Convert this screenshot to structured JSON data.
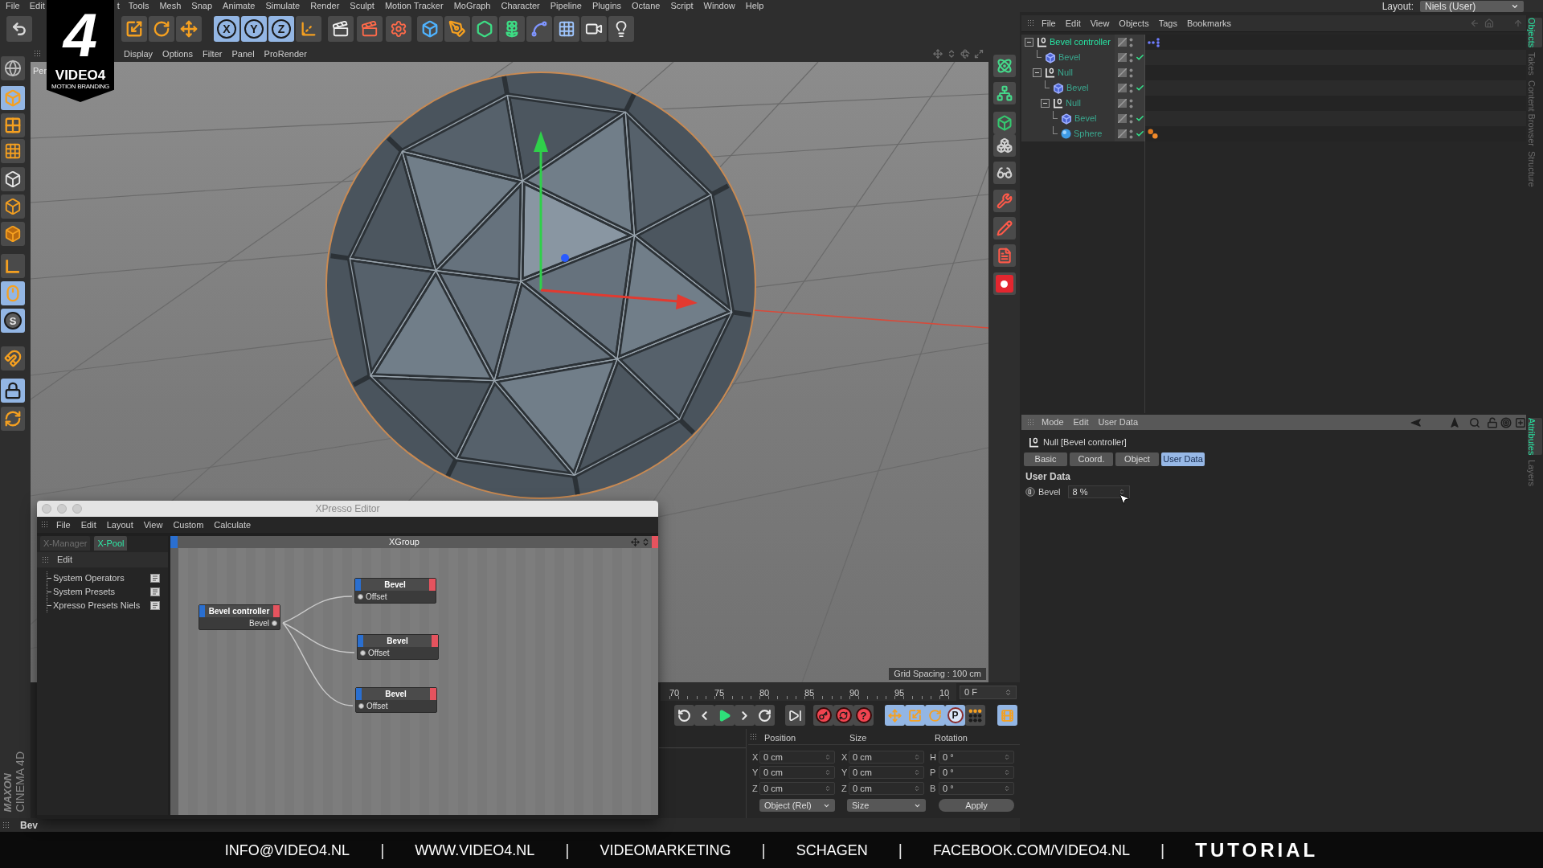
{
  "brand_logo": {
    "mark": "4",
    "name": "VIDEO4",
    "tagline": "MOTION BRANDING"
  },
  "menu_bar": {
    "items": [
      "File",
      "Edit",
      "t",
      "Tools",
      "Mesh",
      "Snap",
      "Animate",
      "Simulate",
      "Render",
      "Sculpt",
      "Motion Tracker",
      "MoGraph",
      "Character",
      "Pipeline",
      "Plugins",
      "Octane",
      "Script",
      "Window",
      "Help"
    ],
    "layout_label": "Layout:",
    "layout_value": "Niels (User)"
  },
  "toolbar": [
    {
      "kind": "undo",
      "on": false
    },
    {
      "kind": "scale",
      "on": false
    },
    {
      "kind": "rotate",
      "on": false
    },
    {
      "kind": "move",
      "on": false
    },
    {
      "kind": "axis",
      "label": "X",
      "on": true
    },
    {
      "kind": "axis",
      "label": "Y",
      "on": true
    },
    {
      "kind": "axis",
      "label": "Z",
      "on": true
    },
    {
      "kind": "coords",
      "on": false
    },
    {
      "kind": "render_view",
      "on": false
    },
    {
      "kind": "render_picture",
      "on": false
    },
    {
      "kind": "render_settings",
      "on": false
    },
    {
      "kind": "cube",
      "on": false
    },
    {
      "kind": "pen",
      "on": false
    },
    {
      "kind": "subdivision",
      "on": false
    },
    {
      "kind": "cloner",
      "on": false
    },
    {
      "kind": "deformer",
      "on": false
    },
    {
      "kind": "floor",
      "on": false
    },
    {
      "kind": "camera",
      "on": false
    },
    {
      "kind": "light",
      "on": false
    }
  ],
  "left_toolbar": [
    {
      "kind": "reference",
      "on": false
    },
    {
      "kind": "model",
      "on": true
    },
    {
      "kind": "texture",
      "on": false
    },
    {
      "kind": "workplane",
      "on": false
    },
    {
      "kind": "points",
      "on": false
    },
    {
      "kind": "edges",
      "on": false
    },
    {
      "kind": "polygons",
      "on": false
    },
    {
      "kind": "axis",
      "on": false
    },
    {
      "kind": "tweak",
      "on": true
    },
    {
      "kind": "solo",
      "label": "S",
      "on": true
    },
    {
      "kind": "snap",
      "on": false
    },
    {
      "kind": "lock_workplane",
      "on": true
    },
    {
      "kind": "align_workplane",
      "on": false
    }
  ],
  "maxon_logo": {
    "brand": "MAXON",
    "product": "CINEMA 4D"
  },
  "viewport": {
    "camera_label": "Per",
    "menu": [
      "Display",
      "Options",
      "Filter",
      "Panel",
      "ProRender"
    ],
    "grid_spacing": "Grid Spacing : 100 cm"
  },
  "timeline": {
    "ticks": [
      "70",
      "75",
      "80",
      "85",
      "90",
      "95",
      "10"
    ],
    "frame_field": "0 F"
  },
  "transport": [
    {
      "kind": "go_start",
      "on": false
    },
    {
      "kind": "prev_key",
      "on": false
    },
    {
      "kind": "play",
      "on": false
    },
    {
      "kind": "next_key",
      "on": false
    },
    {
      "kind": "go_end",
      "on": false
    },
    {
      "kind": "last_frame",
      "on": false
    },
    {
      "kind": "record",
      "on": false
    },
    {
      "kind": "autokey",
      "on": false
    },
    {
      "kind": "key_help",
      "label": "?",
      "on": false
    },
    {
      "kind": "move",
      "on": true
    },
    {
      "kind": "scale",
      "on": true
    },
    {
      "kind": "rotate",
      "on": true
    },
    {
      "kind": "param",
      "label": "P",
      "on": true
    },
    {
      "kind": "pla",
      "on": false
    },
    {
      "kind": "timeline",
      "on": true
    }
  ],
  "coordinates": {
    "headers": [
      "Position",
      "Size",
      "Rotation"
    ],
    "rows": [
      {
        "cells": [
          {
            "axis": "X",
            "value": "0 cm"
          },
          {
            "axis": "X",
            "value": "0 cm"
          },
          {
            "axis": "H",
            "value": "0 °"
          }
        ]
      },
      {
        "cells": [
          {
            "axis": "Y",
            "value": "0 cm"
          },
          {
            "axis": "Y",
            "value": "0 cm"
          },
          {
            "axis": "P",
            "value": "0 °"
          }
        ]
      },
      {
        "cells": [
          {
            "axis": "Z",
            "value": "0 cm"
          },
          {
            "axis": "Z",
            "value": "0 cm"
          },
          {
            "axis": "B",
            "value": "0 °"
          }
        ]
      }
    ],
    "dropdowns": [
      "Object (Rel)",
      "Size"
    ],
    "apply_button": "Apply"
  },
  "status_bar": {
    "text": "Bev"
  },
  "object_manager": {
    "menu": [
      "File",
      "Edit",
      "View",
      "Objects",
      "Tags",
      "Bookmarks"
    ],
    "objects": [
      {
        "name": "Bevel controller",
        "kind": "null",
        "selected": true,
        "expanded": true,
        "tag": {
          "kind": "xpresso"
        },
        "children": [
          {
            "name": "Bevel",
            "kind": "deformer",
            "selected": false,
            "checked": true
          },
          {
            "name": "Null",
            "kind": "null",
            "selected": false,
            "expanded": true,
            "children": [
              {
                "name": "Bevel",
                "kind": "deformer",
                "selected": false,
                "checked": true
              },
              {
                "name": "Null",
                "kind": "null",
                "selected": false,
                "expanded": true,
                "children": [
                  {
                    "name": "Bevel",
                    "kind": "deformer",
                    "selected": false,
                    "checked": true
                  },
                  {
                    "name": "Sphere",
                    "kind": "sphere",
                    "selected": false,
                    "checked": true,
                    "tag": {
                      "kind": "material"
                    }
                  }
                ]
              }
            ]
          }
        ]
      }
    ]
  },
  "attributes": {
    "menu": [
      "Mode",
      "Edit",
      "User Data"
    ],
    "title": "Null [Bevel controller]",
    "tabs": [
      {
        "label": "Basic",
        "selected": false
      },
      {
        "label": "Coord.",
        "selected": false
      },
      {
        "label": "Object",
        "selected": false
      },
      {
        "label": "User Data",
        "selected": true
      }
    ],
    "section": "User Data",
    "fields": [
      {
        "label": "Bevel",
        "value": "8 %"
      }
    ]
  },
  "side_tabs_top": [
    {
      "label": "Objects",
      "selected": true
    },
    {
      "label": "Takes",
      "selected": false
    },
    {
      "label": "Content Browser",
      "selected": false
    },
    {
      "label": "Structure",
      "selected": false
    }
  ],
  "side_tabs_bottom": [
    {
      "label": "Attributes",
      "selected": true
    },
    {
      "label": "Layers",
      "selected": false
    }
  ],
  "xpresso_editor": {
    "title": "XPresso Editor",
    "menu": [
      "File",
      "Edit",
      "Layout",
      "View",
      "Custom",
      "Calculate"
    ],
    "pool_tabs": [
      {
        "label": "X-Manager",
        "selected": false
      },
      {
        "label": "X-Pool",
        "selected": true
      }
    ],
    "pool_menu": "Edit",
    "pool_items": [
      "System Operators",
      "System Presets",
      "Xpresso Presets Niels"
    ],
    "group_title": "XGroup",
    "nodes": [
      {
        "title": "Bevel controller",
        "kind": "output",
        "port": "Bevel"
      },
      {
        "title": "Bevel",
        "kind": "input",
        "port": "Offset",
        "connected": true
      },
      {
        "title": "Bevel",
        "kind": "input",
        "port": "Offset",
        "connected": true
      },
      {
        "title": "Bevel",
        "kind": "input",
        "port": "Offset",
        "connected": true
      }
    ]
  },
  "footer": [
    {
      "kind": "text",
      "text": "INFO@VIDEO4.NL"
    },
    {
      "kind": "separator",
      "text": "|"
    },
    {
      "kind": "text",
      "text": "WWW.VIDEO4.NL"
    },
    {
      "kind": "separator",
      "text": "|"
    },
    {
      "kind": "text",
      "text": "VIDEOMARKETING"
    },
    {
      "kind": "separator",
      "text": "|"
    },
    {
      "kind": "text",
      "text": "SCHAGEN"
    },
    {
      "kind": "separator",
      "text": "|"
    },
    {
      "kind": "text",
      "text": "FACEBOOK.COM/VIDEO4.NL"
    },
    {
      "kind": "separator",
      "text": "|"
    },
    {
      "kind": "label",
      "text": "TUTORIAL"
    }
  ]
}
